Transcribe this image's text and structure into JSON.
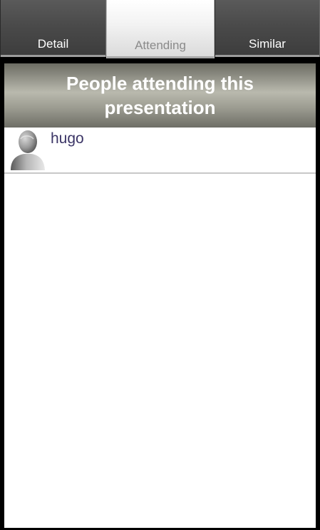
{
  "tabs": [
    {
      "label": "Detail"
    },
    {
      "label": "Attending"
    },
    {
      "label": "Similar"
    }
  ],
  "header": {
    "title": "People attending this presentation"
  },
  "attendees": [
    {
      "name": "hugo",
      "icon": "person-silhouette-icon"
    }
  ],
  "colors": {
    "selected_tab_text": "#8a8a8a",
    "tab_text": "#ffffff",
    "attendee_name": "#3b3566",
    "header_text": "#ffffff"
  }
}
